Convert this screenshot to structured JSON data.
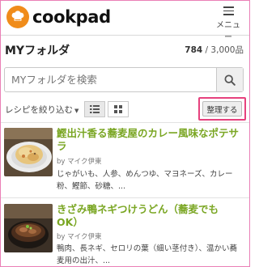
{
  "header": {
    "logo_text": "cookpad",
    "menu_label": "メニュー"
  },
  "page": {
    "title": "MYフォルダ",
    "count_current": "784",
    "count_total": " / 3,000品"
  },
  "search": {
    "placeholder": "MYフォルダを検索"
  },
  "filter": {
    "label": "レシピを絞り込む",
    "organize_label": "整理する"
  },
  "accent_colors": {
    "logo": "#f08c1a",
    "recipe_title": "#7aa623",
    "highlight_border": "#e6417d"
  },
  "recipes": [
    {
      "title": "鰹出汁香る蕎麦屋のカレー風味なポテサラ",
      "author": "by マイク伊東",
      "ingredients": "じゃがいも、人参、めんつゆ、マヨネーズ、カレー粉、鰹節、砂糖、..."
    },
    {
      "title": "きざみ鴨ネギつけうどん（蕎麦でもOK）",
      "author": "by マイク伊東",
      "ingredients": "鴨肉、長ネギ、セロリの葉（細い茎付き）、温かい蕎麦用の出汁、..."
    }
  ]
}
